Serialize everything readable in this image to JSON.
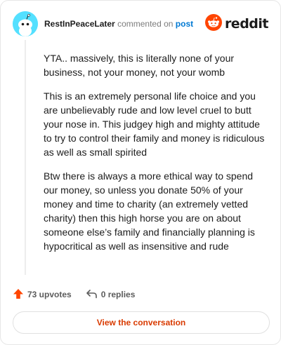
{
  "comment": {
    "author": "RestInPeaceLater",
    "action": "commented on",
    "target": "post",
    "paragraphs": [
      "YTA.. massively, this is literally none of your business, not your money, not your womb",
      "This is an extremely personal life choice and you are unbelievably rude and low level cruel to butt your nose in. This judgey high and mighty attitude to try to control their family and money is ridiculous as well as small spirited",
      "Btw there is always a more ethical way to spend our money, so unless you donate 50% of your money and time to charity (an extremely vetted charity) then this high horse you are on about someone else’s family and financially planning is hypocritical as well as insensitive and rude"
    ],
    "upvotes_label": "73 upvotes",
    "replies_label": "0 replies"
  },
  "brand": {
    "wordmark": "reddit",
    "color": "#ff4500"
  },
  "cta": {
    "label": "View the conversation"
  },
  "colors": {
    "upvote": "#ff4500",
    "link": "#0079d3",
    "cta_text": "#d93a00",
    "avatar_bg": "#54e0ff"
  },
  "icons": {
    "avatar": "snoo-avatar-icon",
    "logo": "reddit-logo-icon",
    "upvote": "upvote-arrow-icon",
    "reply": "reply-arrow-icon"
  }
}
